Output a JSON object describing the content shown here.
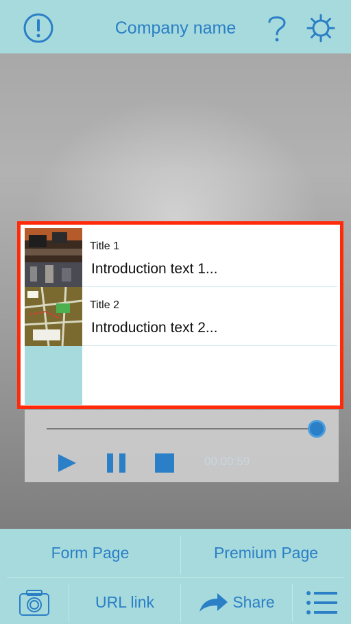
{
  "header": {
    "title": "Company name",
    "icons": [
      "alert-icon",
      "help-icon",
      "gear-icon"
    ]
  },
  "list": {
    "items": [
      {
        "title": "Title 1",
        "text": "Introduction text 1..."
      },
      {
        "title": "Title 2",
        "text": "Introduction text 2..."
      },
      {
        "title": "",
        "text": ""
      }
    ]
  },
  "player": {
    "progress": 1.0,
    "time": "00:00:59",
    "controls": [
      "play-icon",
      "pause-icon",
      "stop-icon"
    ]
  },
  "footer": {
    "form_page": "Form Page",
    "premium_page": "Premium Page",
    "url_link": "URL link",
    "share": "Share",
    "icons": [
      "camera-icon",
      "share-arrow-icon",
      "menu-list-icon"
    ]
  },
  "colors": {
    "accent": "#2a7fc6",
    "bar": "#a7dadc",
    "highlight_frame": "#ff2a0a"
  }
}
